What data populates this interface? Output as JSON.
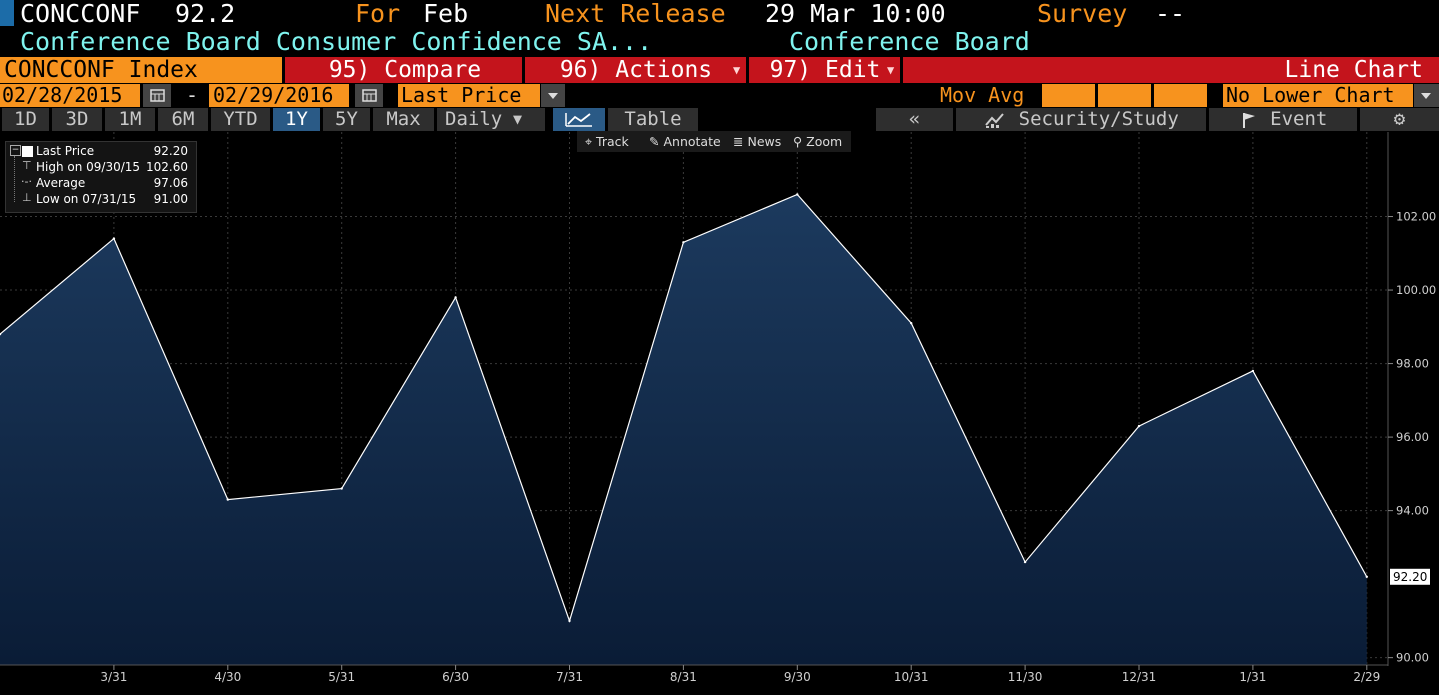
{
  "header": {
    "ticker": "CONCCONF",
    "last_value": "92.2",
    "for_label": "For",
    "for_value": "Feb",
    "next_release_label": "Next Release",
    "next_release_value": "29 Mar 10:00",
    "survey_label": "Survey",
    "survey_value": "--",
    "description": "Conference Board Consumer Confidence SA...",
    "source": "Conference Board"
  },
  "menubar": {
    "security": "CONCCONF Index",
    "compare": "95) Compare",
    "actions": "96) Actions",
    "edit": "97) Edit",
    "chart_type": "Line Chart"
  },
  "daterow": {
    "start_date": "02/28/2015",
    "dash": "-",
    "end_date": "02/29/2016",
    "field": "Last Price",
    "mov_avg": "Mov Avg",
    "lower_chart": "No Lower Chart"
  },
  "periods": {
    "buttons": [
      "1D",
      "3D",
      "1M",
      "6M",
      "YTD",
      "1Y",
      "5Y",
      "Max"
    ],
    "active": "1Y",
    "frequency": "Daily",
    "table": "Table",
    "collapse": "«",
    "security_study": "Security/Study",
    "event": "Event"
  },
  "toolbar": {
    "track": "Track",
    "annotate": "Annotate",
    "news": "News",
    "zoom": "Zoom"
  },
  "legend": {
    "last_label": "Last Price",
    "last_value": "92.20",
    "high_label": "High on 09/30/15",
    "high_value": "102.60",
    "avg_label": "Average",
    "avg_value": "97.06",
    "low_label": "Low on 07/31/15",
    "low_value": "91.00"
  },
  "colors": {
    "line": "#ffffff",
    "area_top": "#1c3a5e",
    "area_bottom": "#0a1c36",
    "accent_orange": "#f7931e",
    "accent_cyan": "#7ff3ee",
    "menu_red": "#c4141c"
  },
  "chart_data": {
    "type": "area",
    "x": [
      "2/28",
      "3/31",
      "4/30",
      "5/31",
      "6/30",
      "7/31",
      "8/31",
      "9/30",
      "10/31",
      "11/30",
      "12/31",
      "1/31",
      "2/29"
    ],
    "x_tick_labels": [
      "3/31",
      "4/30",
      "5/31",
      "6/30",
      "7/31",
      "8/31",
      "9/30",
      "10/31",
      "11/30",
      "12/31",
      "1/31",
      "2/29"
    ],
    "values": [
      98.8,
      101.4,
      94.3,
      94.6,
      99.8,
      91.0,
      101.3,
      102.6,
      99.1,
      92.6,
      96.3,
      97.8,
      92.2
    ],
    "y_ticks": [
      "90.00",
      "94.00",
      "96.00",
      "98.00",
      "100.00",
      "102.00"
    ],
    "ylim": [
      89.8,
      104.3
    ],
    "last_value_label": "92.20",
    "grid": true
  }
}
